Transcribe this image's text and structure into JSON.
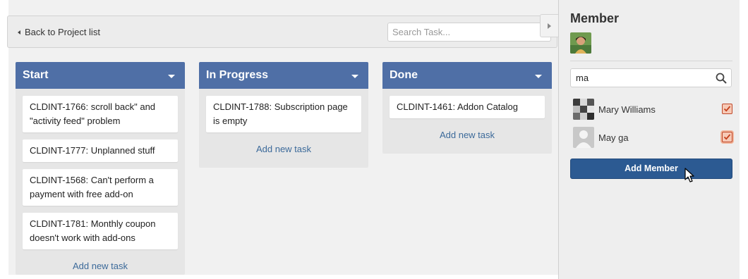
{
  "toolbar": {
    "back_label": "Back to Project list",
    "search_placeholder": "Search Task..."
  },
  "columns": [
    {
      "title": "Start",
      "tasks": [
        "CLDINT-1766: scroll back\" and \"activity feed\" problem",
        "CLDINT-1777: Unplanned stuff",
        "CLDINT-1568: Can't perform a payment with free add-on",
        "CLDINT-1781: Monthly coupon doesn't work with add-ons"
      ],
      "add_label": "Add new task"
    },
    {
      "title": "In Progress",
      "tasks": [
        "CLDINT-1788: Subscription page is empty"
      ],
      "add_label": "Add new task"
    },
    {
      "title": "Done",
      "tasks": [
        "CLDINT-1461: Addon Catalog"
      ],
      "add_label": "Add new task"
    }
  ],
  "sidebar": {
    "title": "Member",
    "search_value": "ma",
    "members": [
      {
        "name": "Mary Williams",
        "checked": true
      },
      {
        "name": "May ga",
        "checked": true
      }
    ],
    "add_button": "Add Member"
  },
  "colors": {
    "column_header": "#4f6fa6",
    "link": "#3c6a9a",
    "primary_button": "#2c5a92",
    "checkbox": "#e2693e"
  }
}
